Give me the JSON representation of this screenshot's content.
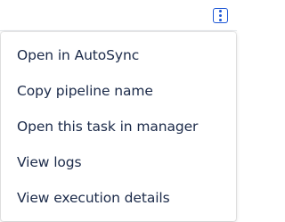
{
  "toolbar": {
    "more_actions_icon": "vertical-ellipsis-icon",
    "accent_color": "#1f58d6"
  },
  "menu": {
    "items": [
      {
        "label": "Open in AutoSync"
      },
      {
        "label": "Copy pipeline name"
      },
      {
        "label": "Open this task in manager"
      },
      {
        "label": "View logs"
      },
      {
        "label": "View execution details"
      }
    ]
  },
  "colors": {
    "menu_text": "#1b2a49",
    "menu_background": "#ffffff"
  }
}
